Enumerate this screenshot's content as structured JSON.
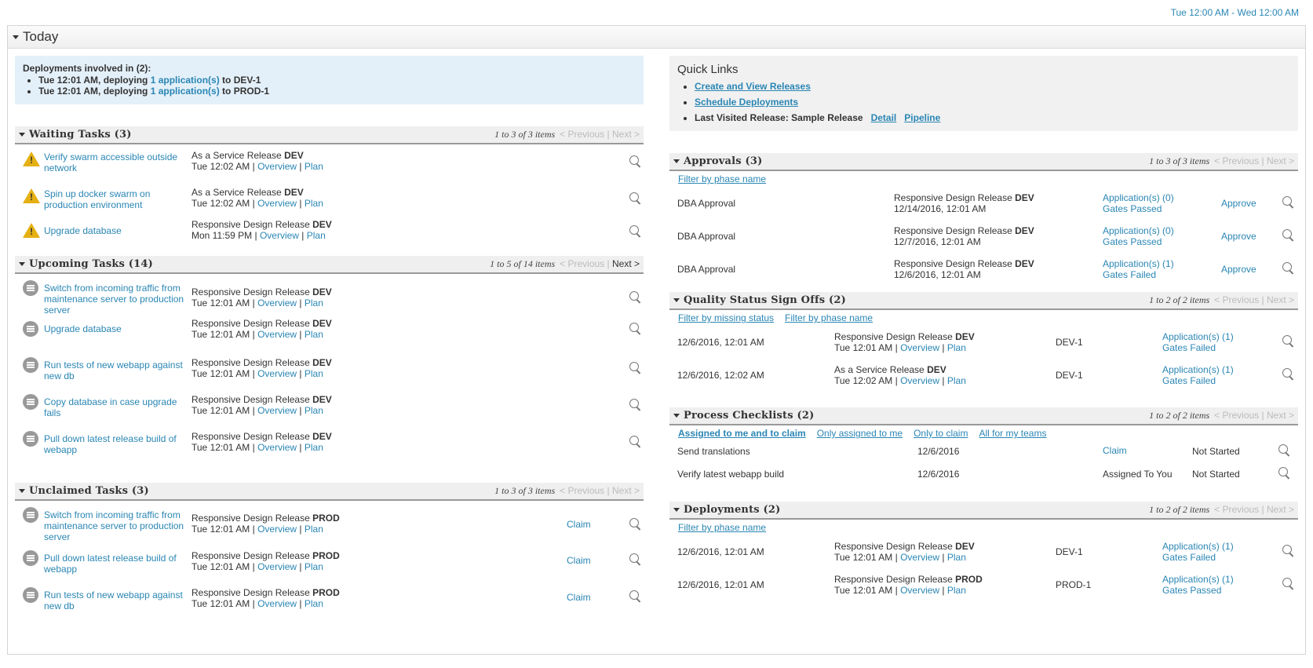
{
  "daterange": "Tue 12:00 AM - Wed 12:00 AM",
  "panel": {
    "title": "Today"
  },
  "deployments_box": {
    "lead": "Deployments involved in (2):",
    "items": [
      {
        "pre": "Tue 12:01 AM, deploying ",
        "link": "1 application(s)",
        "post": " to DEV-1"
      },
      {
        "pre": "Tue 12:01 AM, deploying ",
        "link": "1 application(s)",
        "post": " to PROD-1"
      }
    ]
  },
  "quick_links": {
    "title": "Quick Links",
    "create": "Create and View Releases",
    "schedule": "Schedule Deployments",
    "last_visited": "Last Visited Release: Sample Release",
    "detail": "Detail",
    "pipeline": "Pipeline"
  },
  "common": {
    "overview": "Overview",
    "plan": "Plan",
    "sep": " | ",
    "previous": "< Previous",
    "next": "Next >",
    "bar": " | ",
    "claim": "Claim",
    "approve": "Approve"
  },
  "waiting": {
    "title": "Waiting Tasks (3)",
    "pager": "1 to 3 of 3 items",
    "rows": [
      {
        "name": "Verify swarm accessible outside network",
        "release": "As a Service Release ",
        "env": "DEV",
        "time": "Tue 12:02 AM"
      },
      {
        "name": "Spin up docker swarm on production environment",
        "release": "As a Service Release ",
        "env": "DEV",
        "time": "Tue 12:02 AM"
      },
      {
        "name": "Upgrade database",
        "release": "Responsive Design Release ",
        "env": "DEV",
        "time": "Mon 11:59 PM"
      }
    ]
  },
  "upcoming": {
    "title": "Upcoming Tasks (14)",
    "pager": "1 to 5 of 14 items",
    "rows": [
      {
        "name": "Switch from incoming traffic from maintenance server to production server",
        "release": "Responsive Design Release ",
        "env": "DEV",
        "time": "Tue 12:01 AM"
      },
      {
        "name": "Upgrade database",
        "release": "Responsive Design Release ",
        "env": "DEV",
        "time": "Tue 12:01 AM"
      },
      {
        "name": "Run tests of new webapp against new db",
        "release": "Responsive Design Release ",
        "env": "DEV",
        "time": "Tue 12:01 AM"
      },
      {
        "name": "Copy database in case upgrade fails",
        "release": "Responsive Design Release ",
        "env": "DEV",
        "time": "Tue 12:01 AM"
      },
      {
        "name": "Pull down latest release build of webapp",
        "release": "Responsive Design Release ",
        "env": "DEV",
        "time": "Tue 12:01 AM"
      }
    ]
  },
  "unclaimed": {
    "title": "Unclaimed Tasks (3)",
    "pager": "1 to 3 of 3 items",
    "rows": [
      {
        "name": "Switch from incoming traffic from maintenance server to production server",
        "release": "Responsive Design Release ",
        "env": "PROD",
        "time": "Tue 12:01 AM"
      },
      {
        "name": "Pull down latest release build of webapp",
        "release": "Responsive Design Release ",
        "env": "PROD",
        "time": "Tue 12:01 AM"
      },
      {
        "name": "Run tests of new webapp against new db",
        "release": "Responsive Design Release ",
        "env": "PROD",
        "time": "Tue 12:01 AM"
      }
    ]
  },
  "approvals": {
    "title": "Approvals (3)",
    "pager": "1 to 3 of 3 items",
    "filter": "Filter by phase name",
    "rows": [
      {
        "name": "DBA Approval",
        "release": "Responsive Design Release ",
        "env": "DEV",
        "date": "12/14/2016, 12:01 AM",
        "apps": "Application(s) (0)",
        "gates": "Gates Passed"
      },
      {
        "name": "DBA Approval",
        "release": "Responsive Design Release ",
        "env": "DEV",
        "date": "12/7/2016, 12:01 AM",
        "apps": "Application(s) (0)",
        "gates": "Gates Passed"
      },
      {
        "name": "DBA Approval",
        "release": "Responsive Design Release ",
        "env": "DEV",
        "date": "12/6/2016, 12:01 AM",
        "apps": "Application(s) (1)",
        "gates": "Gates Failed"
      }
    ]
  },
  "quality": {
    "title": "Quality Status Sign Offs (2)",
    "pager": "1 to 2 of 2 items",
    "filter_missing": "Filter by missing status",
    "filter_phase": "Filter by phase name",
    "rows": [
      {
        "date": "12/6/2016, 12:01 AM",
        "release": "Responsive Design Release ",
        "env": "DEV",
        "time": "Tue 12:01 AM",
        "target": "DEV-1",
        "apps": "Application(s) (1)",
        "gates": "Gates Failed"
      },
      {
        "date": "12/6/2016, 12:02 AM",
        "release": "As a Service Release ",
        "env": "DEV",
        "time": "Tue 12:02 AM",
        "target": "DEV-1",
        "apps": "Application(s) (1)",
        "gates": "Gates Failed"
      }
    ]
  },
  "checklists": {
    "title": "Process Checklists (2)",
    "pager": "1 to 2 of 2 items",
    "filters": [
      "Assigned to me and to claim",
      "Only assigned to me",
      "Only to claim",
      "All for my teams"
    ],
    "rows": [
      {
        "name": "Send translations",
        "date": "12/6/2016",
        "assign": "Claim",
        "status": "Not Started"
      },
      {
        "name": "Verify latest webapp build",
        "date": "12/6/2016",
        "assign": "Assigned To You",
        "status": "Not Started"
      }
    ]
  },
  "deployments": {
    "title": "Deployments (2)",
    "pager": "1 to 2 of 2 items",
    "filter": "Filter by phase name",
    "rows": [
      {
        "date": "12/6/2016, 12:01 AM",
        "release": "Responsive Design Release ",
        "env": "DEV",
        "time": "Tue 12:01 AM",
        "target": "DEV-1",
        "apps": "Application(s) (1)",
        "gates": "Gates Failed"
      },
      {
        "date": "12/6/2016, 12:01 AM",
        "release": "Responsive Design Release ",
        "env": "PROD",
        "time": "Tue 12:01 AM",
        "target": "PROD-1",
        "apps": "Application(s) (1)",
        "gates": "Gates Passed"
      }
    ]
  }
}
